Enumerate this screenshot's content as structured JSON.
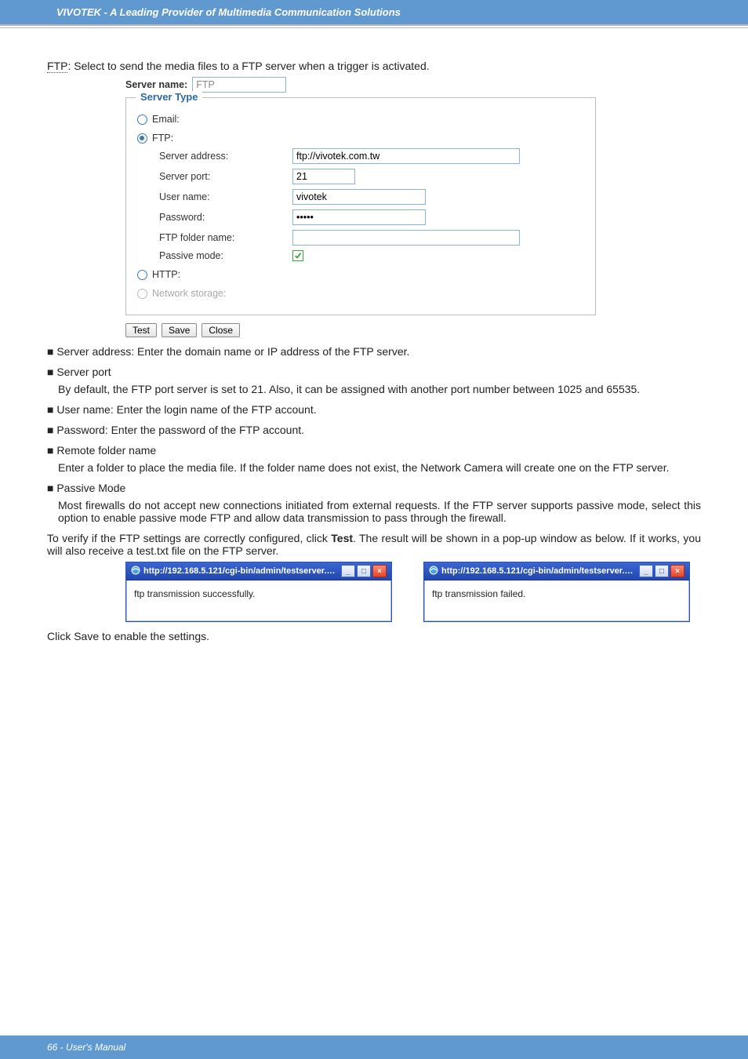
{
  "header": {
    "title": "VIVOTEK - A Leading Provider of Multimedia Communication Solutions"
  },
  "intro": {
    "label": "FTP",
    "text": ": Select to send the media files to a FTP server when a trigger is activated."
  },
  "srv": {
    "name_label": "Server name:",
    "name_value": "FTP",
    "legend": "Server Type",
    "email_label": "Email:",
    "ftp_label": "FTP:",
    "rows": {
      "addr_label": "Server address:",
      "addr_value": "ftp://vivotek.com.tw",
      "port_label": "Server port:",
      "port_value": "21",
      "user_label": "User name:",
      "user_value": "vivotek",
      "pass_label": "Password:",
      "pass_value": "•••••",
      "folder_label": "FTP folder name:",
      "folder_value": "",
      "passive_label": "Passive mode:"
    },
    "http_label": "HTTP:",
    "ns_label": "Network storage:",
    "buttons": {
      "test": "Test",
      "save": "Save",
      "close": "Close"
    }
  },
  "bullets": {
    "b1": "■ Server address: Enter the domain name or IP address of the FTP server.",
    "b2_head": "■ Server port",
    "b2_body": "By default, the FTP port server is set to 21. Also, it can be assigned with another port  number between 1025 and 65535.",
    "b3": "■ User name: Enter the login name of the FTP account.",
    "b4": "■ Password: Enter the password of the FTP account.",
    "b5_head": "■ Remote folder name",
    "b5_body": "Enter a folder to place the media file. If the folder name does not exist, the Network Camera will create one on the FTP server.",
    "b6_head": "■ Passive Mode",
    "b6_body": "Most firewalls do not accept new connections initiated from external requests. If the FTP server supports passive mode, select this option to enable passive mode FTP and allow data transmission to pass through the firewall."
  },
  "verify": {
    "pre": "To verify if the FTP settings are correctly configured, click ",
    "bold": "Test",
    "post": ". The result will be shown in a pop-up window as below. If it works, you will also receive a test.txt file on the FTP server."
  },
  "popup": {
    "title": "http://192.168.5.121/cgi-bin/admin/testserver.cgi - ...",
    "ok": "ftp transmission successfully.",
    "fail": "ftp transmission failed."
  },
  "after": "Click Save to enable the settings.",
  "footer": "66 - User's Manual"
}
